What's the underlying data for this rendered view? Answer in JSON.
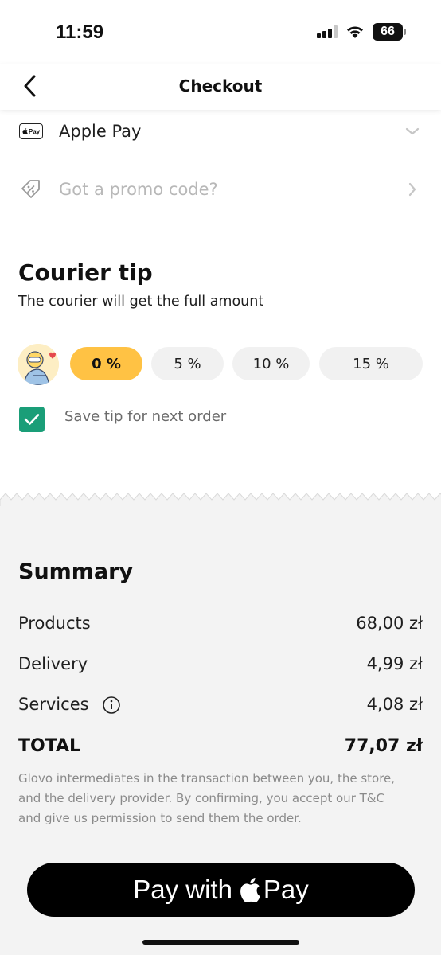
{
  "status_bar": {
    "time": "11:59",
    "battery": "66",
    "icons": [
      "signal-icon",
      "wifi-icon",
      "battery-icon"
    ]
  },
  "header": {
    "title": "Checkout",
    "back_icon": "chevron-left-icon"
  },
  "payment": {
    "method_label": "Apple Pay",
    "icon": "apple-pay-card-icon",
    "badge_text": "Pay",
    "expand_icon": "chevron-down-icon"
  },
  "promo": {
    "placeholder": "Got a promo code?",
    "icon": "tag-percent-icon",
    "chevron_icon": "chevron-right-icon"
  },
  "courier_tip": {
    "title": "Courier tip",
    "subtitle": "The courier will get the full amount",
    "options": [
      {
        "label": "0 %",
        "selected": true
      },
      {
        "label": "5 %",
        "selected": false
      },
      {
        "label": "10 %",
        "selected": false
      },
      {
        "label": "15 %",
        "selected": false
      }
    ],
    "save_tip": {
      "label": "Save tip for next order",
      "checked": true
    }
  },
  "summary": {
    "title": "Summary",
    "lines": [
      {
        "label": "Products",
        "value": "68,00 zł"
      },
      {
        "label": "Delivery",
        "value": "4,99 zł"
      },
      {
        "label": "Services",
        "value": "4,08 zł",
        "info_icon": "info-icon"
      }
    ],
    "total": {
      "label": "TOTAL",
      "value": "77,07 zł"
    },
    "disclaimer": "Glovo intermediates in the transaction between you, the store, and the delivery provider. By confirming, you accept our T&C and give us permission to send them the order."
  },
  "pay_button": {
    "prefix": "Pay with",
    "suffix": "Pay",
    "icon": "apple-logo-icon"
  },
  "colors": {
    "accent_yellow": "#ffc244",
    "checkbox_green": "#1a9e78",
    "summary_bg": "#f3f3f3",
    "pay_button_bg": "#000000"
  }
}
